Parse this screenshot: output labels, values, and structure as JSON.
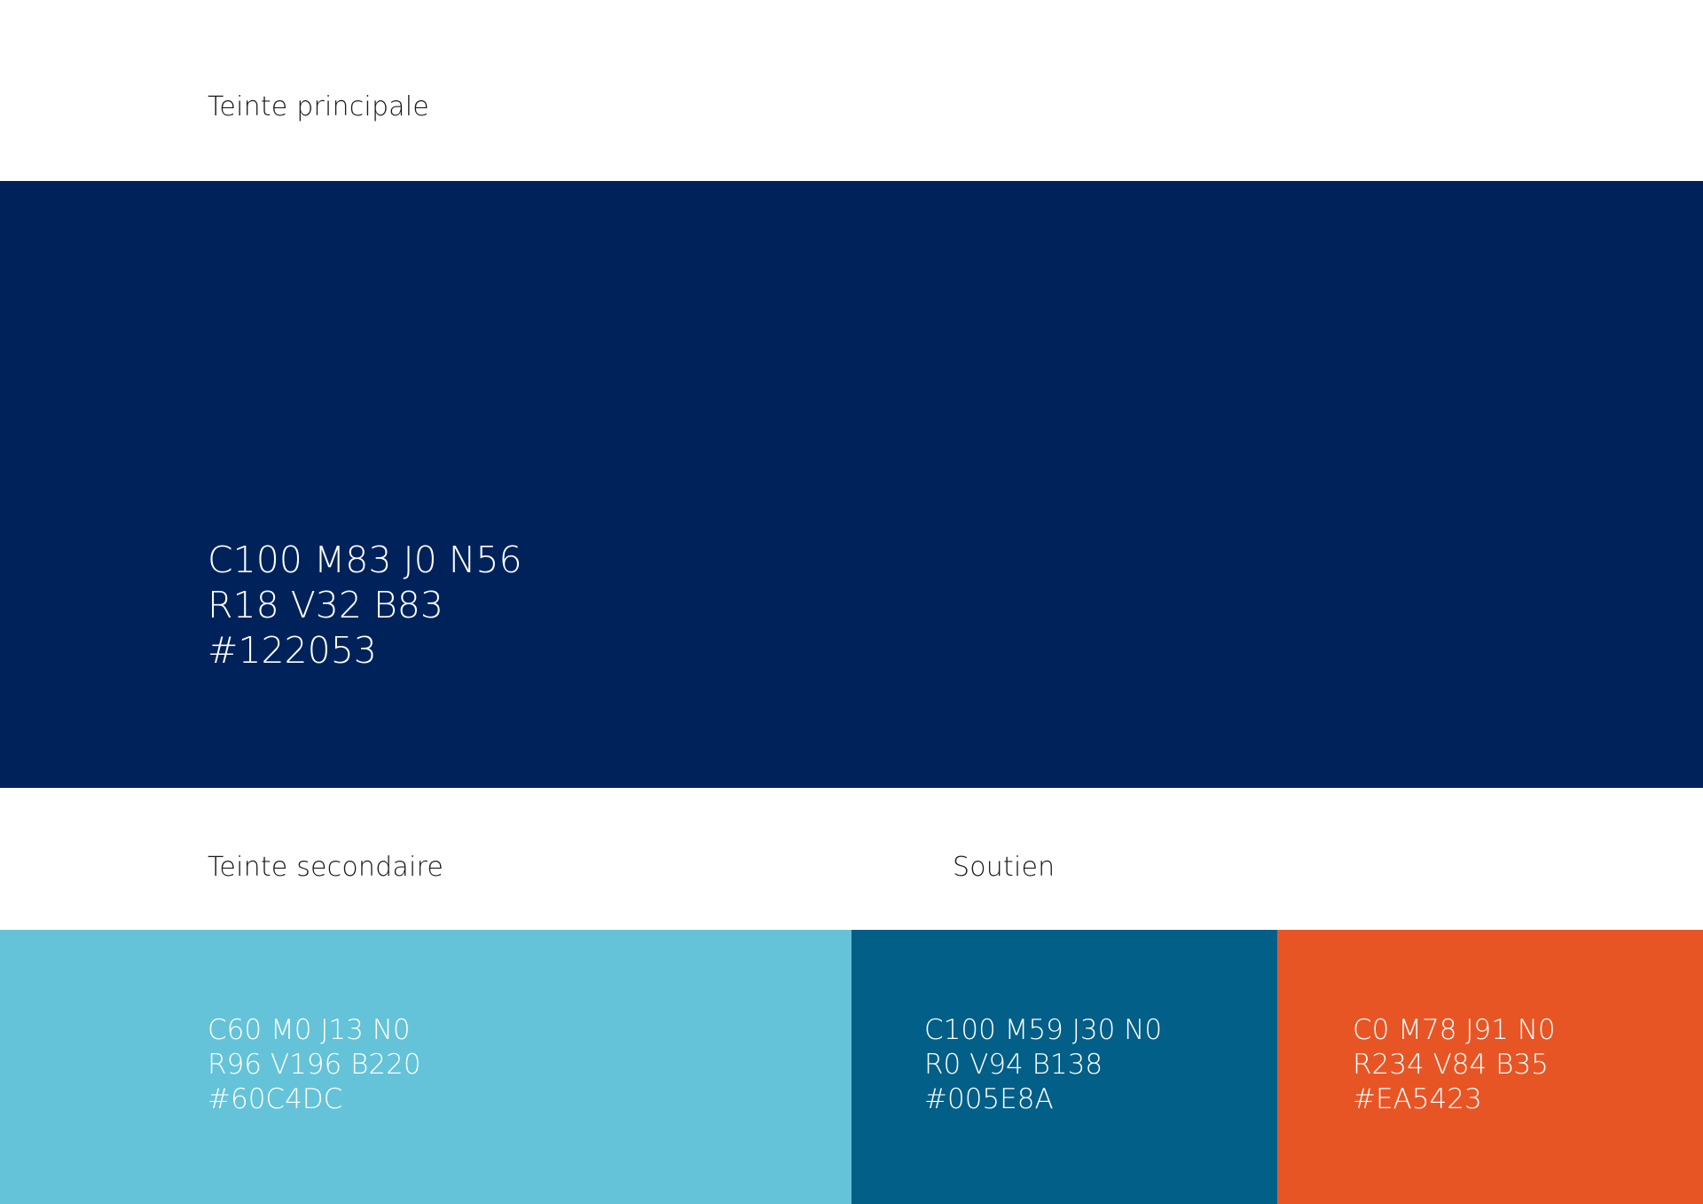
{
  "primary": {
    "label": "Teinte principale",
    "color": "#00225a",
    "cmyk": "C100 M83 J0 N56",
    "rgb": "R18 V32 B83",
    "hex": "#122053"
  },
  "secondary": {
    "label": "Teinte secondaire",
    "color": "#64c3d8",
    "cmyk": "C60 M0 J13 N0",
    "rgb": "R96 V196 B220",
    "hex": "#60C4DC"
  },
  "support": {
    "label": "Soutien",
    "swatches": [
      {
        "color": "#025f88",
        "cmyk": "C100 M59 J30 N0",
        "rgb": "R0 V94 B138",
        "hex": "#005E8A"
      },
      {
        "color": "#e85525",
        "cmyk": "C0 M78 J91 N0",
        "rgb": "R234 V84 B35",
        "hex": "#EA5423"
      }
    ]
  }
}
